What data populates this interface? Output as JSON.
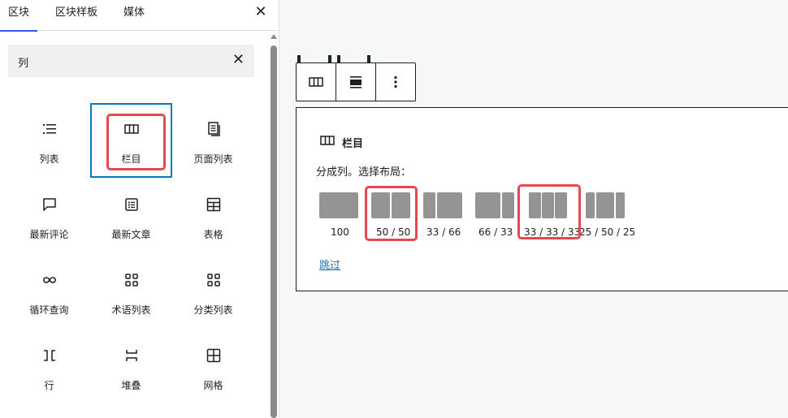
{
  "inserter": {
    "tabs": [
      {
        "label": "区块"
      },
      {
        "label": "区块样板"
      },
      {
        "label": "媒体"
      }
    ],
    "close_icon": "close-icon",
    "search": {
      "value": "列",
      "clear_icon": "close-icon"
    },
    "blocks": [
      {
        "label": "列表",
        "icon": "list-icon"
      },
      {
        "label": "栏目",
        "icon": "columns-icon"
      },
      {
        "label": "页面列表",
        "icon": "page-list-icon"
      },
      {
        "label": "最新评论",
        "icon": "comment-icon"
      },
      {
        "label": "最新文章",
        "icon": "post-list-icon"
      },
      {
        "label": "表格",
        "icon": "table-icon"
      },
      {
        "label": "循环查询",
        "icon": "loop-icon"
      },
      {
        "label": "术语列表",
        "icon": "terms-icon"
      },
      {
        "label": "分类列表",
        "icon": "categories-icon"
      },
      {
        "label": "行",
        "icon": "row-icon"
      },
      {
        "label": "堆叠",
        "icon": "stack-icon"
      },
      {
        "label": "网格",
        "icon": "grid-icon"
      }
    ]
  },
  "editor": {
    "toolbar": {
      "buttons": [
        {
          "icon": "columns-icon"
        },
        {
          "icon": "align-icon"
        },
        {
          "icon": "more-options-icon"
        }
      ]
    },
    "placeholder": {
      "title": "栏目",
      "instructions": "分成列。选择布局：",
      "variations": [
        {
          "label": "100"
        },
        {
          "label": "50 / 50"
        },
        {
          "label": "33 / 66"
        },
        {
          "label": "66 / 33"
        },
        {
          "label": "33 / 33 / 33"
        },
        {
          "label": "25 / 50 / 25"
        }
      ],
      "skip": "跳过"
    }
  },
  "colors": {
    "highlight": "#e5484d",
    "accent": "#007cba",
    "link": "#2271b1"
  }
}
